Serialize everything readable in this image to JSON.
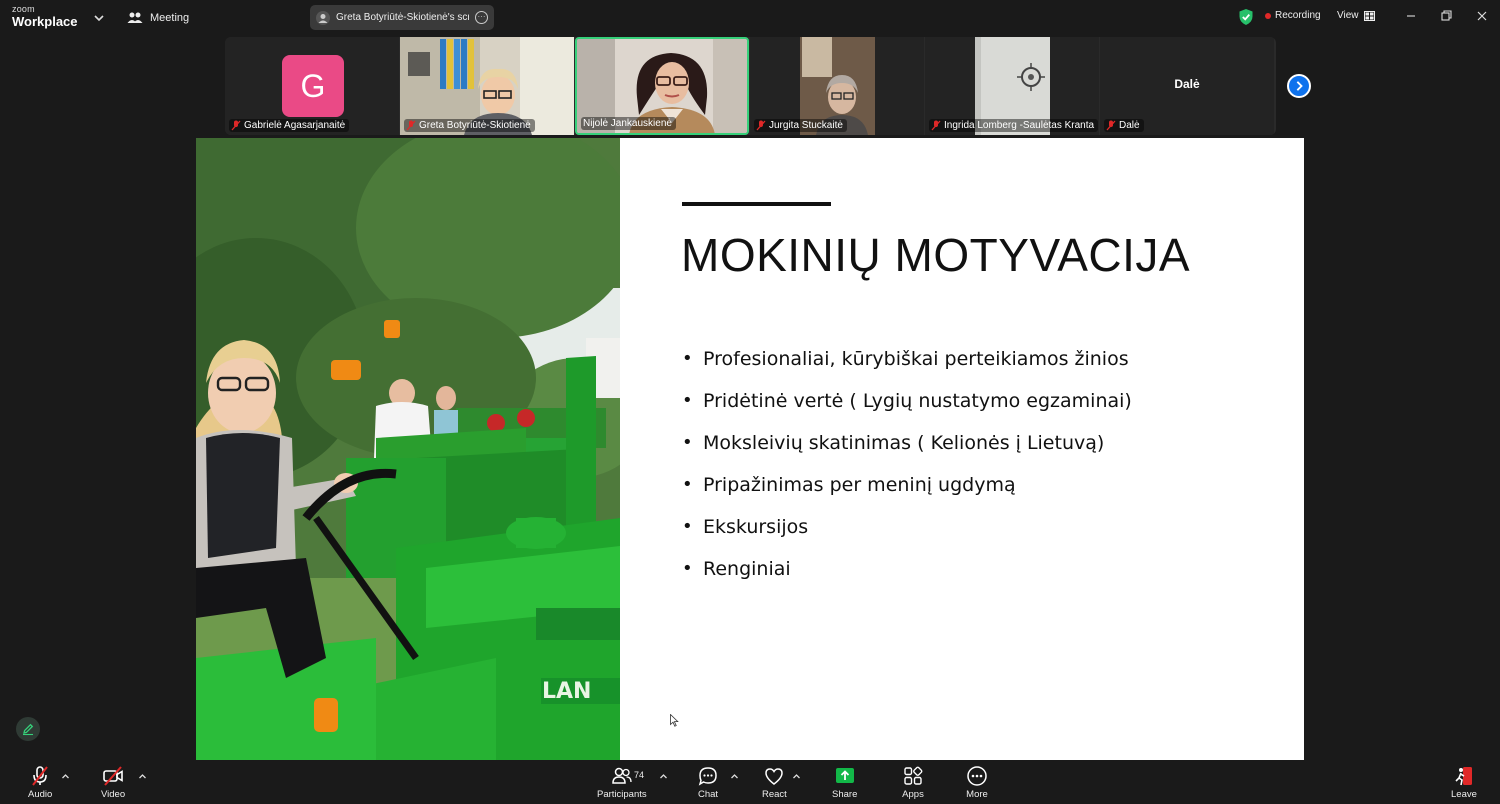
{
  "app": {
    "logo_top": "zoom",
    "logo_bottom": "Workplace",
    "meeting_label": "Meeting"
  },
  "share_pill": {
    "label": "Greta Botyriūtė-Skiotienė's scree"
  },
  "status": {
    "recording_label": "Recording",
    "view_label": "View"
  },
  "participants_strip": [
    {
      "name": "Gabrielė Agasarjanaitė",
      "avatar_letter": "G",
      "muted": true,
      "video": false
    },
    {
      "name": "Greta Botyriūtė-Skiotienė",
      "muted": true,
      "video": true
    },
    {
      "name": "Nijolė Jankauskienė",
      "muted": false,
      "video": true,
      "active_speaker": true
    },
    {
      "name": "Jurgita Stuckaitė",
      "muted": true,
      "video": true
    },
    {
      "name": "Ingrida Lomberg -Saulėtas Kranta",
      "muted": true,
      "video": true
    },
    {
      "name": "Dalė",
      "big_label": "Dalė",
      "muted": true,
      "video": false
    }
  ],
  "slide": {
    "title": "MOKINIŲ MOTYVACIJA",
    "bullets": [
      "Profesionaliai, kūrybiškai perteikiamos žinios",
      "Pridėtinė vertė ( Lygių nustatymo egzaminai)",
      "Moksleivių skatinimas ( Kelionės į Lietuvą)",
      "Pripažinimas per meninį ugdymą",
      "Ekskursijos",
      "Renginiai"
    ],
    "photo_text": "LAN"
  },
  "toolbar": {
    "audio": "Audio",
    "video": "Video",
    "participants": "Participants",
    "participants_count": "74",
    "chat": "Chat",
    "react": "React",
    "share": "Share",
    "apps": "Apps",
    "more": "More",
    "leave": "Leave"
  },
  "colors": {
    "background": "#1a1a1a",
    "active_speaker": "#36d07a",
    "share_green": "#12b848",
    "leave_red": "#e02828",
    "avatar_pink": "#ea4a86",
    "accent_blue": "#0e72ed"
  }
}
